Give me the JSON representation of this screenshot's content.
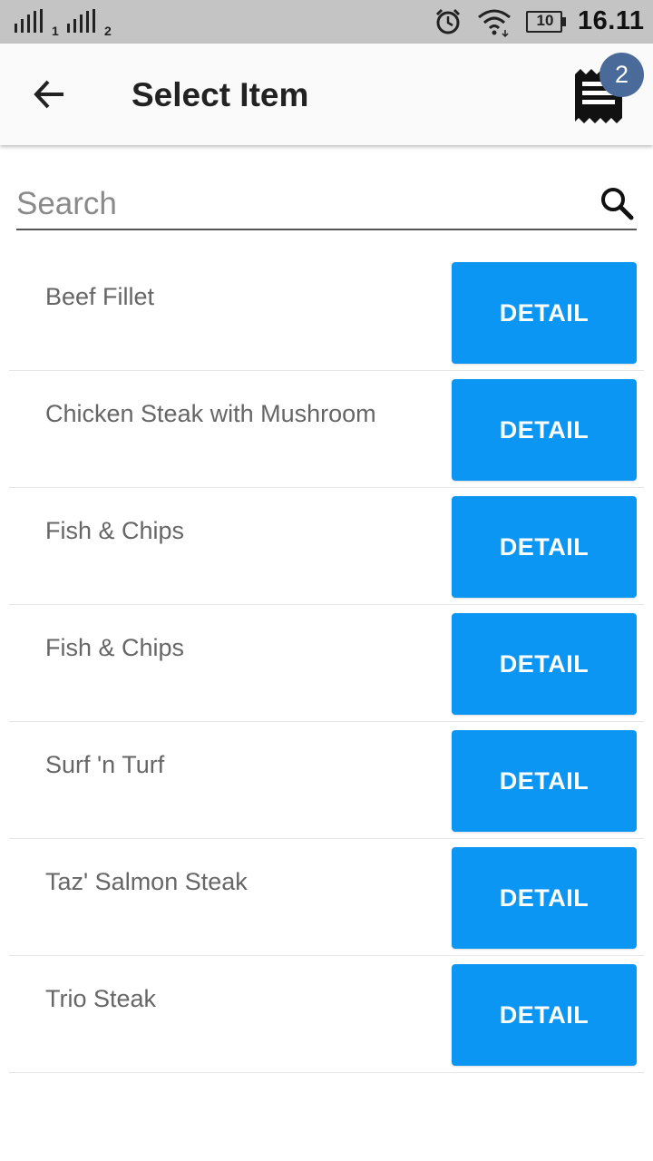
{
  "status_bar": {
    "sim1_label": "1",
    "sim2_label": "2",
    "battery_level": "10",
    "time": "16.11",
    "icons": [
      "signal-sim1-icon",
      "signal-sim2-icon",
      "alarm-icon",
      "wifi-icon",
      "battery-icon"
    ]
  },
  "app_bar": {
    "title": "Select Item",
    "back_icon": "arrow-left-icon",
    "cart_icon": "receipt-icon",
    "cart_count": "2",
    "badge_color": "#4a6a9a"
  },
  "search": {
    "placeholder": "Search",
    "value": "",
    "icon": "search-icon"
  },
  "items": [
    {
      "name": "Beef Fillet",
      "button_label": "DETAIL"
    },
    {
      "name": "Chicken Steak with Mushroom",
      "button_label": "DETAIL"
    },
    {
      "name": "Fish & Chips",
      "button_label": "DETAIL"
    },
    {
      "name": "Fish & Chips",
      "button_label": "DETAIL"
    },
    {
      "name": "Surf 'n Turf",
      "button_label": "DETAIL"
    },
    {
      "name": "Taz' Salmon Steak",
      "button_label": "DETAIL"
    },
    {
      "name": "Trio Steak",
      "button_label": "DETAIL"
    }
  ],
  "colors": {
    "accent": "#0a96f2",
    "status_bar": "#c4c4c4",
    "app_bar": "#fafafa"
  }
}
